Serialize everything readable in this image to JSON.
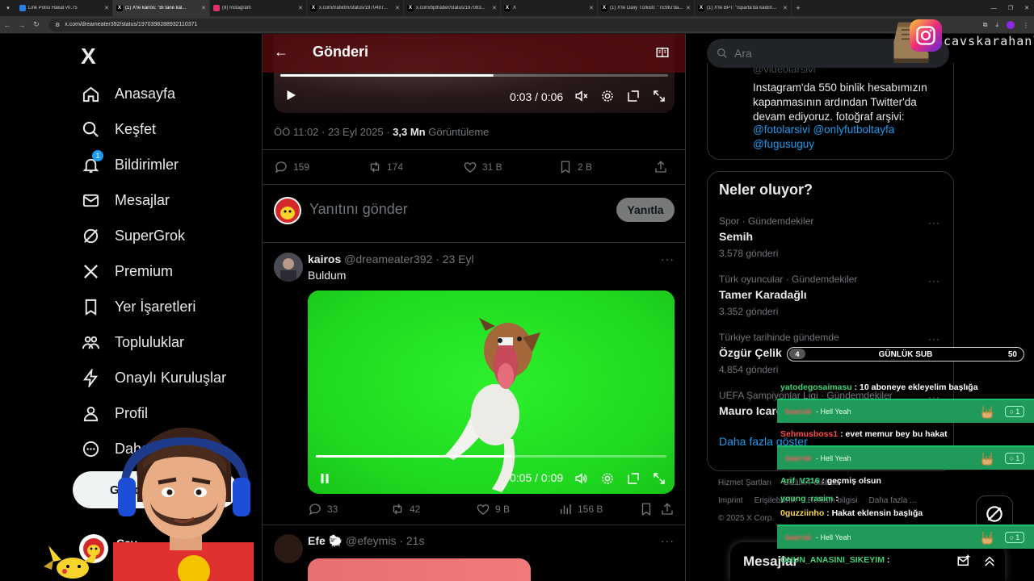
{
  "browser": {
    "tabs": [
      {
        "label": "Link Polisi Hakat v0.75",
        "color": "#2b7de9",
        "glyph": ""
      },
      {
        "label": "(1) X'te kairos: \"Bi tane kal...",
        "color": "#000000",
        "glyph": "X",
        "active": true
      },
      {
        "label": "(9) Instagram",
        "color": "#e1306c",
        "glyph": ""
      },
      {
        "label": "x.com/trafiktm/status/1970497...",
        "color": "#000000",
        "glyph": "X"
      },
      {
        "label": "x.com/bpthaber/status/197083...",
        "color": "#000000",
        "glyph": "X"
      },
      {
        "label": "X",
        "color": "#000000",
        "glyph": "X"
      },
      {
        "label": "(1) X'te Daily Türkisti: \"TEMU'da...",
        "color": "#000000",
        "glyph": "X"
      },
      {
        "label": "(1) X'te BPT: \"Isparta'da kaldırı...",
        "color": "#000000",
        "glyph": "X"
      }
    ],
    "url": "x.com/dreameater392/status/1970398288932110371"
  },
  "left_nav": {
    "logo": "X",
    "items": [
      {
        "label": "Anasayfa",
        "icon": "home-icon"
      },
      {
        "label": "Keşfet",
        "icon": "search-icon"
      },
      {
        "label": "Bildirimler",
        "icon": "bell-icon",
        "badge": "1"
      },
      {
        "label": "Mesajlar",
        "icon": "mail-icon"
      },
      {
        "label": "SuperGrok",
        "icon": "grok-icon"
      },
      {
        "label": "Premium",
        "icon": "x-premium-icon"
      },
      {
        "label": "Yer İşaretleri",
        "icon": "bookmark-icon"
      },
      {
        "label": "Topluluklar",
        "icon": "communities-icon"
      },
      {
        "label": "Onaylı Kuruluşlar",
        "icon": "lightning-icon"
      },
      {
        "label": "Profil",
        "icon": "person-icon"
      },
      {
        "label": "Daha fazla",
        "icon": "more-circle-icon"
      }
    ],
    "post_button": "Gönderi yayınla",
    "account": {
      "name": "Cav",
      "handle": "@c"
    }
  },
  "main": {
    "header_title": "Gönderi",
    "top_video": {
      "time": "0:03 / 0:06",
      "progress": 0.55
    },
    "meta": {
      "time": "ÖÖ 11:02 · 23 Eyl 2025 · ",
      "views": "3,3 Mn",
      "views_label": " Görüntüleme"
    },
    "stats": {
      "replies": "159",
      "reposts": "174",
      "likes": "31 B",
      "bookmarks": "2 B"
    },
    "reply_placeholder": "Yanıtını gönder",
    "reply_button": "Yanıtla",
    "reply_tweet": {
      "name": "kairos",
      "handle": "@dreameater392 · 23 Eyl",
      "text": "Buldum",
      "video_time": "0:05 / 0:09",
      "progress": 0.56,
      "stats": {
        "replies": "33",
        "reposts": "42",
        "likes": "9 B",
        "views": "156 B"
      }
    },
    "next_tweet": {
      "name": "Efe 🐑",
      "handle": "@efeymis · 21s"
    }
  },
  "right": {
    "search_placeholder": "Ara",
    "bio": {
      "handle": "@videolarsivi",
      "text": "Instagram'da 550 binlik hesabımızın kapanmasının ardından Twitter'da devam ediyoruz. fotoğraf arşivi:",
      "links": "@fotolarsivi @onlyfutboltayfa @fugusuguy"
    },
    "trends_title": "Neler oluyor?",
    "trends": [
      {
        "context": "Spor · Gündemdekiler",
        "name": "Semih",
        "count": "3.578 gönderi"
      },
      {
        "context": "Türk oyuncular · Gündemdekiler",
        "name": "Tamer Karadağlı",
        "count": "3.352 gönderi"
      },
      {
        "context": "Türkiye tarihinde gündemde",
        "name": "Özgür Çelik",
        "count": "4.854 gönderi"
      },
      {
        "context": "UEFA Şampiyonlar Ligi · Gündemdekiler",
        "name": "Mauro Icardi",
        "count": ""
      }
    ],
    "show_more": "Daha fazla göster",
    "footer": [
      "Hizmet Şartları",
      "Gizlilik Politikası",
      "Imprint",
      "Erişilebilirlik",
      "Reklam bilgisi",
      "Daha fazla ...",
      "© 2025 X Corp."
    ],
    "messages_title": "Mesajlar"
  },
  "overlay": {
    "instagram_name": "cavskarahanli",
    "sub_goal": {
      "current": "4",
      "label": "GÜNLÜK SUB",
      "max": "50",
      "progress": 0.08
    },
    "chat": [
      {
        "user": "yatodegosaimasu",
        "text": " : 10 aboneye ekleyelim başlığa",
        "color": "#3fd17a"
      },
      {
        "user": "Sehmusboss1",
        "text": " : evet memur bey bu hakat",
        "color": "#ff4d4d"
      },
      {
        "user": "Arif_V216",
        "text": " : geçmiş olsun",
        "color": "#3fd17a"
      },
      {
        "user": "young_rasim",
        "text": " :",
        "color": "#3fd17a"
      },
      {
        "user": "0guzziinho",
        "text": " : Hakat eklensin başlığa",
        "color": "#ffd84a"
      },
      {
        "user": "ONUN_ANASINI_SIKEYIM",
        "text": " :",
        "color": "#3fd17a"
      }
    ],
    "alert_user": "baarrak",
    "alert_text": "- Hell Yeah",
    "alert_count": "1"
  }
}
